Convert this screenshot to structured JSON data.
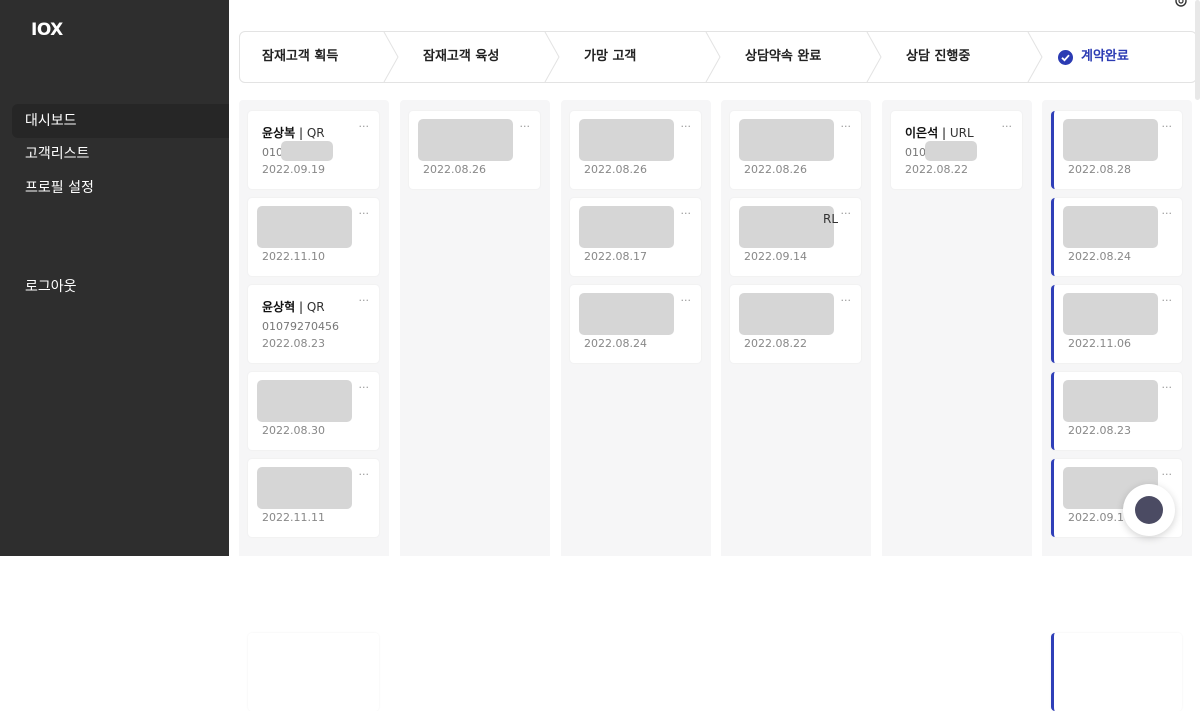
{
  "sidebar": {
    "logo": "IOX",
    "items": [
      {
        "label": "대시보드"
      },
      {
        "label": "고객리스트"
      },
      {
        "label": "프로필 설정"
      },
      {
        "label": "로그아웃"
      }
    ]
  },
  "steps": [
    {
      "label": "잠재고객 획득"
    },
    {
      "label": "잠재고객 육성"
    },
    {
      "label": "가망 고객"
    },
    {
      "label": "상담약속 완료"
    },
    {
      "label": "상담 진행중"
    },
    {
      "label": "계약완료"
    }
  ],
  "columns": [
    {
      "cards": [
        {
          "name": "윤상복",
          "source": "QR",
          "phone": "010",
          "date": "2022.09.19"
        },
        {
          "date": "2022.11.10"
        },
        {
          "name": "윤상혁",
          "source": "QR",
          "phone": "01079270456",
          "date": "2022.08.23"
        },
        {
          "date": "2022.08.30"
        },
        {
          "date": "2022.11.11"
        }
      ]
    },
    {
      "cards": [
        {
          "date": "2022.08.26"
        }
      ]
    },
    {
      "cards": [
        {
          "date": "2022.08.26"
        },
        {
          "date": "2022.08.17"
        },
        {
          "date": "2022.08.24"
        }
      ]
    },
    {
      "cards": [
        {
          "date": "2022.08.26"
        },
        {
          "date": "2022.09.14",
          "peek": "RL"
        },
        {
          "date": "2022.08.22"
        }
      ]
    },
    {
      "cards": [
        {
          "name": "이은석",
          "source": "URL",
          "phone": "010",
          "date": "2022.08.22"
        }
      ]
    },
    {
      "cards": [
        {
          "date": "2022.08.28"
        },
        {
          "date": "2022.08.24"
        },
        {
          "date": "2022.11.06"
        },
        {
          "date": "2022.08.23"
        },
        {
          "date": "2022.09.18"
        }
      ]
    }
  ],
  "more_glyph": "···",
  "source_separator": "|",
  "colors": {
    "sidebar_bg": "#2e2e2e",
    "accent": "#2b3bb3",
    "column_bg": "#f6f6f7",
    "redaction": "#d6d6d6"
  },
  "icons": [
    "settings-icon",
    "check-circle-icon",
    "more-icon",
    "chat-icon"
  ]
}
